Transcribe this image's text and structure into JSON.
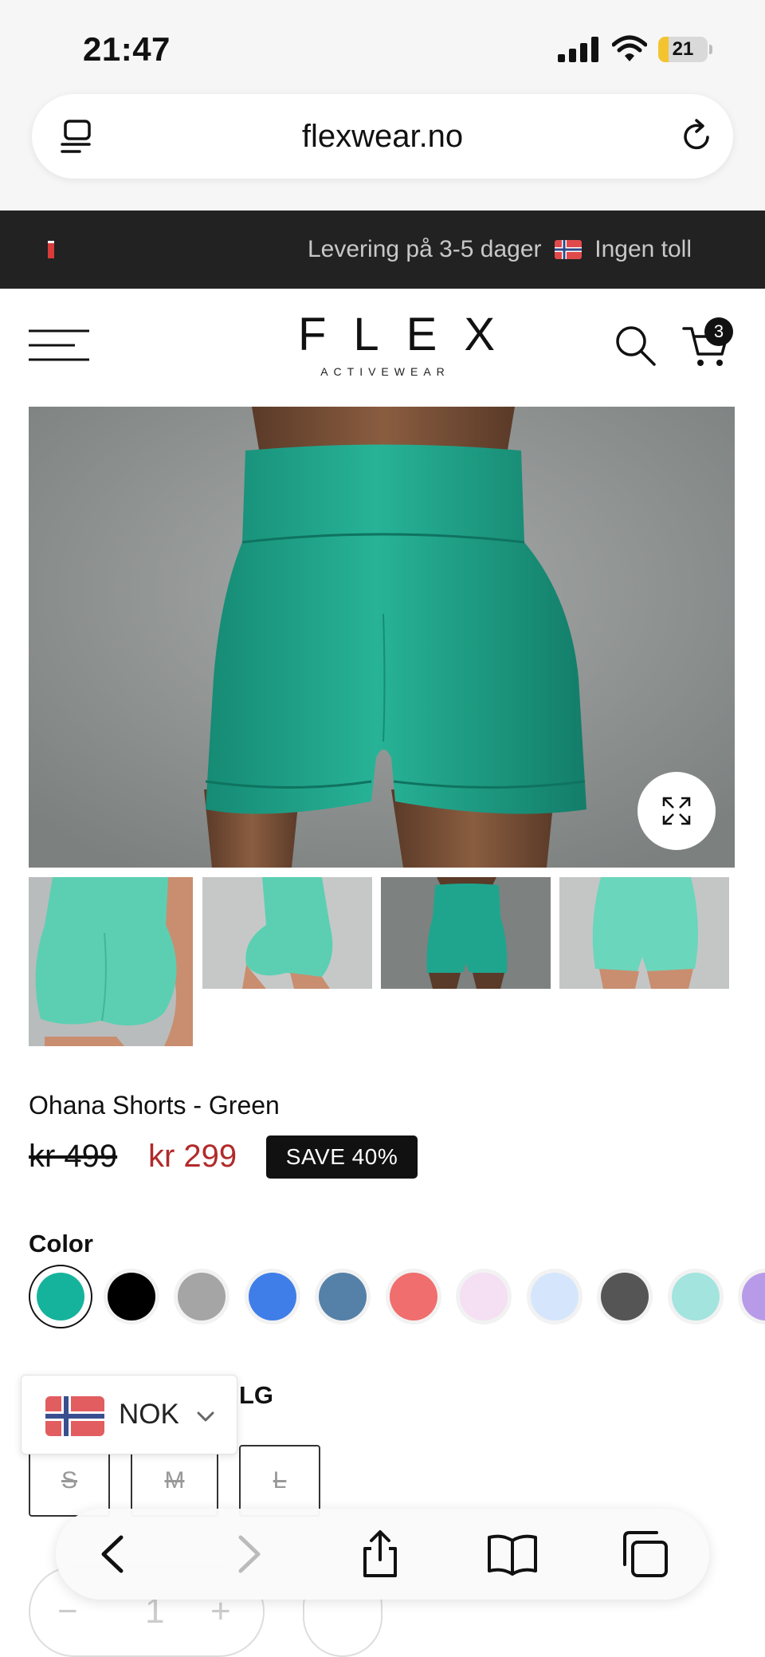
{
  "status_bar": {
    "time": "21:47",
    "battery": "21",
    "battery_level": 0.21
  },
  "browser": {
    "url": "flexwear.no"
  },
  "announcement": {
    "text_before": "Levering på 3-5 dager",
    "text_after": "Ingen toll"
  },
  "header": {
    "logo": "FLEX",
    "logo_sub": "ACTIVEWEAR",
    "cart_count": "3"
  },
  "product": {
    "title": "Ohana Shorts - Green",
    "price_old": "kr 499",
    "price_new": "kr 299",
    "save_badge": "SAVE 40%"
  },
  "color": {
    "label": "Color",
    "swatches": [
      "#15b39c",
      "#000000",
      "#a5a5a5",
      "#3f7ee8",
      "#5580a8",
      "#f06e6e",
      "#f4e0f2",
      "#d5e6fc",
      "#555555",
      "#a3e4df",
      "#b79ae8"
    ],
    "selected_index": 0
  },
  "size": {
    "label_visible": "LG",
    "options": [
      "S",
      "M",
      "L"
    ]
  },
  "currency": {
    "code": "NOK"
  },
  "quantity": {
    "minus": "−",
    "value": "1",
    "plus": "+"
  },
  "colors": {
    "announcement_bg": "#222222",
    "sale_price": "#b22a2a",
    "product_green": "#1fa58d"
  }
}
